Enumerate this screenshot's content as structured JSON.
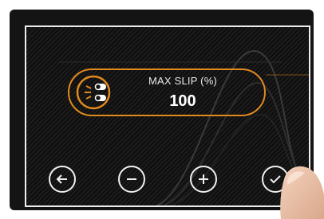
{
  "setting": {
    "label": "MAX SLIP (%)",
    "value": "100"
  },
  "controls": {
    "back": {
      "icon": "arrow-left-icon"
    },
    "decrease": {
      "icon": "minus-icon"
    },
    "increase": {
      "icon": "plus-icon"
    },
    "confirm": {
      "icon": "check-icon"
    }
  },
  "colors": {
    "accent": "#e08a1e",
    "text": "#ffffff",
    "button_outline": "#f0f0f0",
    "background": "#141414"
  }
}
